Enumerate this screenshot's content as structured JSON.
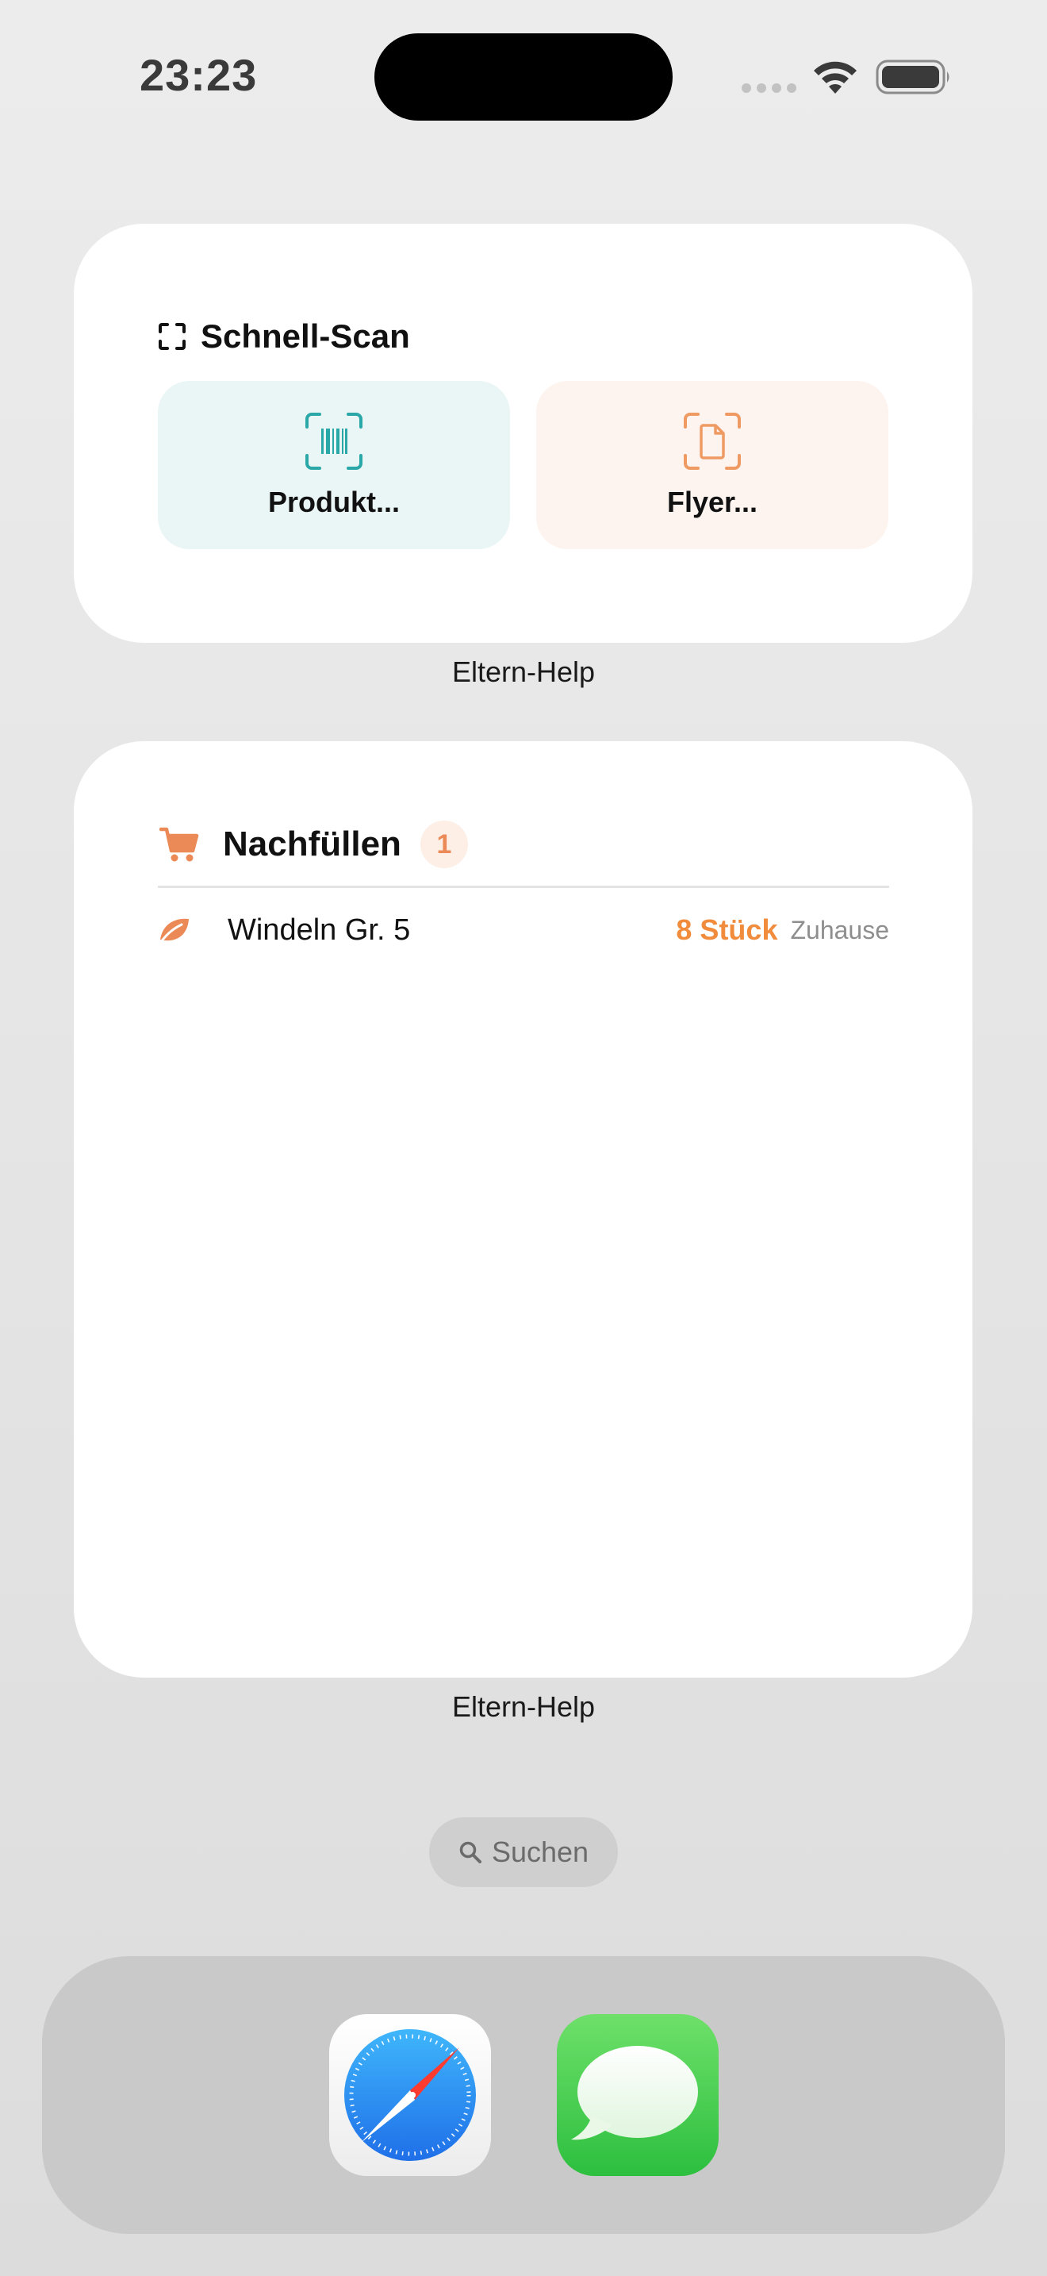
{
  "status_bar": {
    "time": "23:23"
  },
  "scan_widget": {
    "title": "Schnell-Scan",
    "header_icon": "scan-frame-icon",
    "buttons": [
      {
        "label": "Produkt...",
        "icon": "barcode-scan-icon",
        "accent": "#2aa7a7"
      },
      {
        "label": "Flyer...",
        "icon": "document-scan-icon",
        "accent": "#ee9a62"
      }
    ],
    "caption": "Eltern-Help"
  },
  "refill_widget": {
    "title": "Nachfüllen",
    "badge": "1",
    "header_icon": "cart-icon",
    "items": [
      {
        "icon": "leaf-icon",
        "name": "Windeln Gr. 5",
        "quantity": "8 Stück",
        "location": "Zuhause"
      }
    ],
    "caption": "Eltern-Help"
  },
  "search": {
    "label": "Suchen"
  },
  "dock": {
    "apps": [
      {
        "name": "Safari",
        "icon": "safari-icon"
      },
      {
        "name": "Messages",
        "icon": "messages-icon"
      }
    ]
  },
  "colors": {
    "accent_orange": "#f08c3c",
    "accent_teal": "#2aa7a7",
    "badge_bg": "#fdeee6"
  }
}
